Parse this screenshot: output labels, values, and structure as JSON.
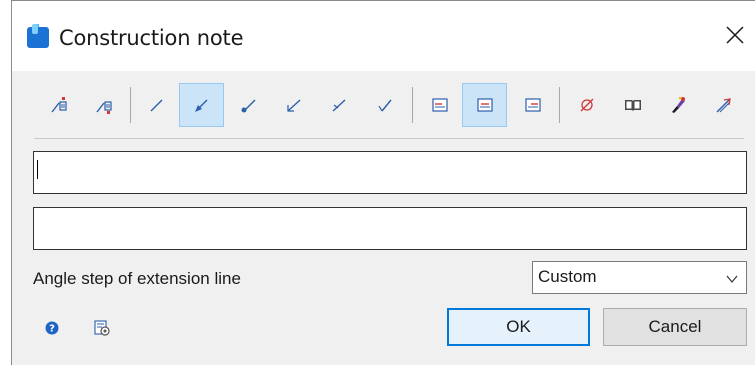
{
  "window": {
    "title": "Construction note",
    "app_icon": "app-logo-icon",
    "close_icon": "close-icon"
  },
  "toolbar": {
    "buttons": [
      {
        "icon": "insert-note-before-icon",
        "selected": false
      },
      {
        "icon": "insert-note-after-icon",
        "selected": false
      },
      {
        "icon": "leader-line-plain-icon",
        "selected": false
      },
      {
        "icon": "leader-line-arrow-icon",
        "selected": true
      },
      {
        "icon": "leader-line-dot-icon",
        "selected": false
      },
      {
        "icon": "leader-line-open-arrow-icon",
        "selected": false
      },
      {
        "icon": "leader-line-tick-icon",
        "selected": false
      },
      {
        "icon": "leader-line-hook-icon",
        "selected": false
      },
      {
        "icon": "align-left-icon",
        "selected": false
      },
      {
        "icon": "align-center-icon",
        "selected": true
      },
      {
        "icon": "align-right-icon",
        "selected": false
      },
      {
        "icon": "diameter-symbol-icon",
        "selected": false
      },
      {
        "icon": "symbol-library-icon",
        "selected": false
      },
      {
        "icon": "color-brush-icon",
        "selected": false
      },
      {
        "icon": "pick-text-icon",
        "selected": false
      }
    ]
  },
  "fields": {
    "line1_value": "",
    "line2_value": ""
  },
  "angle": {
    "label": "Angle step of extension line",
    "selected_option": "Custom"
  },
  "footer": {
    "help_icon": "help-icon",
    "settings_icon": "settings-icon",
    "ok_label": "OK",
    "cancel_label": "Cancel"
  },
  "colors": {
    "accent": "#0078d7",
    "selected_bg": "#cce4f7",
    "icon_blue": "#2b5fad",
    "icon_red": "#d0383a"
  }
}
